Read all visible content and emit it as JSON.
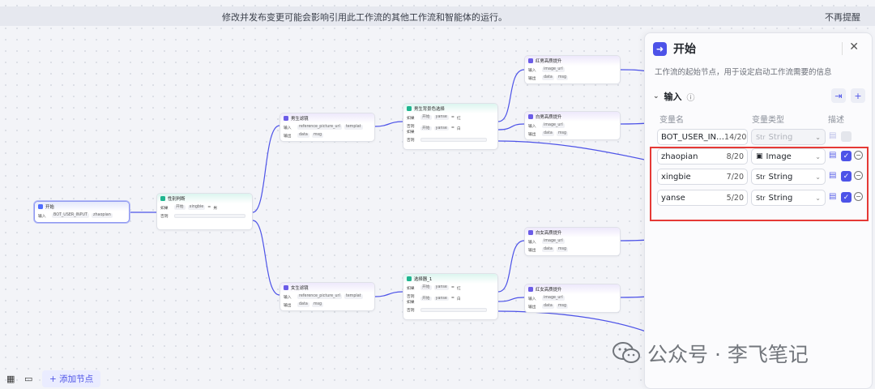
{
  "banner": {
    "message": "修改并发布变更可能会影响引用此工作流的其他工作流和智能体的运行。",
    "dismiss": "不再提醒"
  },
  "nodes": {
    "start": {
      "title": "开始",
      "input_label": "输入",
      "input_values": [
        "BOT_USER_INPUT",
        "zhaopian"
      ]
    },
    "gender_cond": {
      "title": "性别判断",
      "if_label": "如果",
      "else_label": "否则",
      "ref": "开始",
      "var": "xingbie",
      "eq": "=",
      "val": "男"
    },
    "male_pic": {
      "title": "男生滤镜",
      "input_label": "输入",
      "output_label": "输出",
      "inputs": [
        "reference_picture_url",
        "templat"
      ],
      "outputs": [
        "data",
        "msg"
      ]
    },
    "female_pic": {
      "title": "女生滤镜",
      "input_label": "输入",
      "output_label": "输出",
      "inputs": [
        "reference_picture_url",
        "templat"
      ],
      "outputs": [
        "data",
        "msg"
      ]
    },
    "male_color": {
      "title": "男生背景色选择",
      "if_label": "如果",
      "elif_label": "否则如果",
      "else_label": "否则",
      "ref": "开始",
      "var": "yanse",
      "eq": "=",
      "val1": "红",
      "val2": "白"
    },
    "female_color": {
      "title": "选择器_1",
      "if_label": "如果",
      "elif_label": "否则如果",
      "else_label": "否则",
      "ref": "开始",
      "var": "yanse",
      "eq": "=",
      "val1": "红",
      "val2": "白"
    },
    "red_male": {
      "title": "红男高质提升",
      "input_label": "输入",
      "output_label": "输出",
      "inputs": [
        "image_url"
      ],
      "outputs": [
        "data",
        "msg"
      ]
    },
    "white_male": {
      "title": "白男高质提升",
      "input_label": "输入",
      "output_label": "输出",
      "inputs": [
        "image_url"
      ],
      "outputs": [
        "data",
        "msg"
      ]
    },
    "white_female": {
      "title": "白女高质提升",
      "input_label": "输入",
      "output_label": "输出",
      "inputs": [
        "image_url"
      ],
      "outputs": [
        "data",
        "msg"
      ]
    },
    "red_female": {
      "title": "红女高质提升",
      "input_label": "输入",
      "output_label": "输出",
      "inputs": [
        "image_url"
      ],
      "outputs": [
        "data",
        "msg"
      ]
    }
  },
  "panel": {
    "title": "开始",
    "description": "工作流的起始节点，用于设定启动工作流需要的信息",
    "section": "输入",
    "col_name": "变量名",
    "col_type": "变量类型",
    "col_desc": "描述",
    "rows": [
      {
        "name": "BOT_USER_IN…",
        "count": "14/20",
        "type": "String",
        "disabled": true
      },
      {
        "name": "zhaopian",
        "count": "8/20",
        "type": "Image",
        "disabled": false
      },
      {
        "name": "xingbie",
        "count": "7/20",
        "type": "String",
        "disabled": false
      },
      {
        "name": "yanse",
        "count": "5/20",
        "type": "String",
        "disabled": false
      }
    ]
  },
  "toolbar": {
    "add_node": "+ 添加节点"
  },
  "watermark": {
    "text": "公众号 · 李飞笔记"
  },
  "colors": {
    "accent": "#4d53e8",
    "highlight": "#e53935"
  }
}
